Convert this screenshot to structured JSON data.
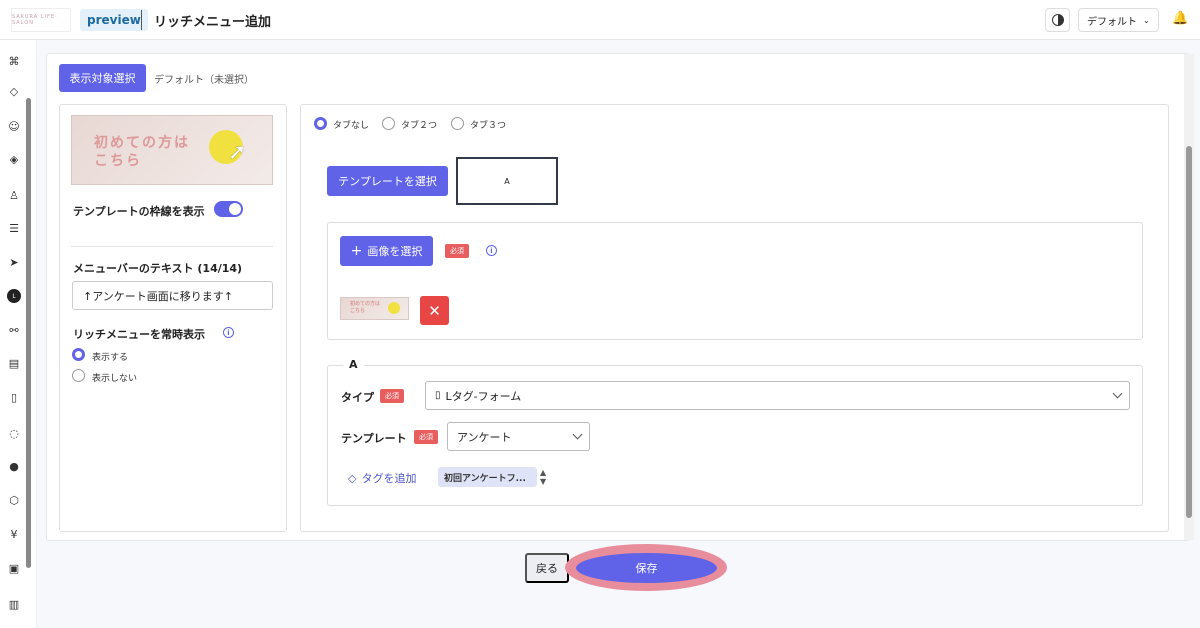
{
  "header": {
    "logo_text": "SAKURA LIFE SALON",
    "preview_badge": "preview",
    "title": "リッチメニュー追加",
    "theme_icon": "contrast-icon",
    "display_select": "デフォルト",
    "bell_icon": "bell-icon"
  },
  "sidebar": {
    "icons": [
      "dashboard-icon",
      "tag-icon",
      "smile-icon",
      "ticket-icon",
      "user-icon",
      "list-icon",
      "send-icon",
      "line-icon",
      "flow-icon",
      "form-icon",
      "document-icon",
      "chat-icon",
      "location-icon",
      "box-icon",
      "yen-icon",
      "calendar-icon",
      "chart-icon"
    ]
  },
  "tabs": {
    "target_select": "表示対象選択",
    "default_status": "デフォルト（未選択）"
  },
  "left": {
    "preview_text_line1": "初めての方は",
    "preview_text_line2": "こちら",
    "frame_toggle_label": "テンプレートの枠線を表示",
    "menubar_label": "メニューバーのテキスト (14/14)",
    "menubar_value": "↑アンケート画面に移ります↑",
    "always_show_label": "リッチメニューを常時表示",
    "radio_show": "表示する",
    "radio_hide": "表示しない"
  },
  "right": {
    "tab_options": [
      "タブなし",
      "タブ２つ",
      "タブ３つ"
    ],
    "template_button": "テンプレートを選択",
    "template_preview_label": "A",
    "image_button": "画像を選択",
    "required": "必須",
    "delete_icon": "close-icon",
    "area_label": "A",
    "type_label": "タイプ",
    "type_value": "Lタグ-フォーム",
    "template_label": "テンプレート",
    "template_value": "アンケート",
    "tag_add": "タグを追加",
    "tag_chip": "初回アンケートフ..."
  },
  "footer": {
    "back": "戻る",
    "save": "保存"
  },
  "colors": {
    "primary": "#6063e8",
    "danger": "#e84545",
    "highlight": "#e88d9c"
  }
}
